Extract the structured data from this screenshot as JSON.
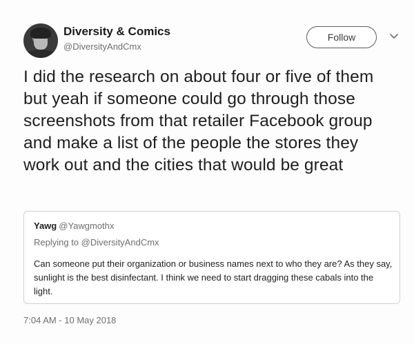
{
  "tweet": {
    "author": {
      "display_name": "Diversity & Comics",
      "handle": "@DiversityAndCmx"
    },
    "follow_label": "Follow",
    "text": "I did the research on about four or five of them but yeah if someone could go through those screenshots from that retailer Facebook group and make a list of the people the stores they work out and the cities that would be great",
    "timestamp": "7:04 AM - 10 May 2018"
  },
  "quoted_tweet": {
    "author_name": "Yawg",
    "author_handle": "@Yawgmothx",
    "replying_to": "Replying to @DiversityAndCmx",
    "text": "Can someone put their organization or business names next to who they are? As they say, sunlight is the best disinfectant. I think we need to start dragging these cabals into the light."
  },
  "icons": {
    "avatar": "user-avatar-photo",
    "more": "chevron-down-icon"
  }
}
